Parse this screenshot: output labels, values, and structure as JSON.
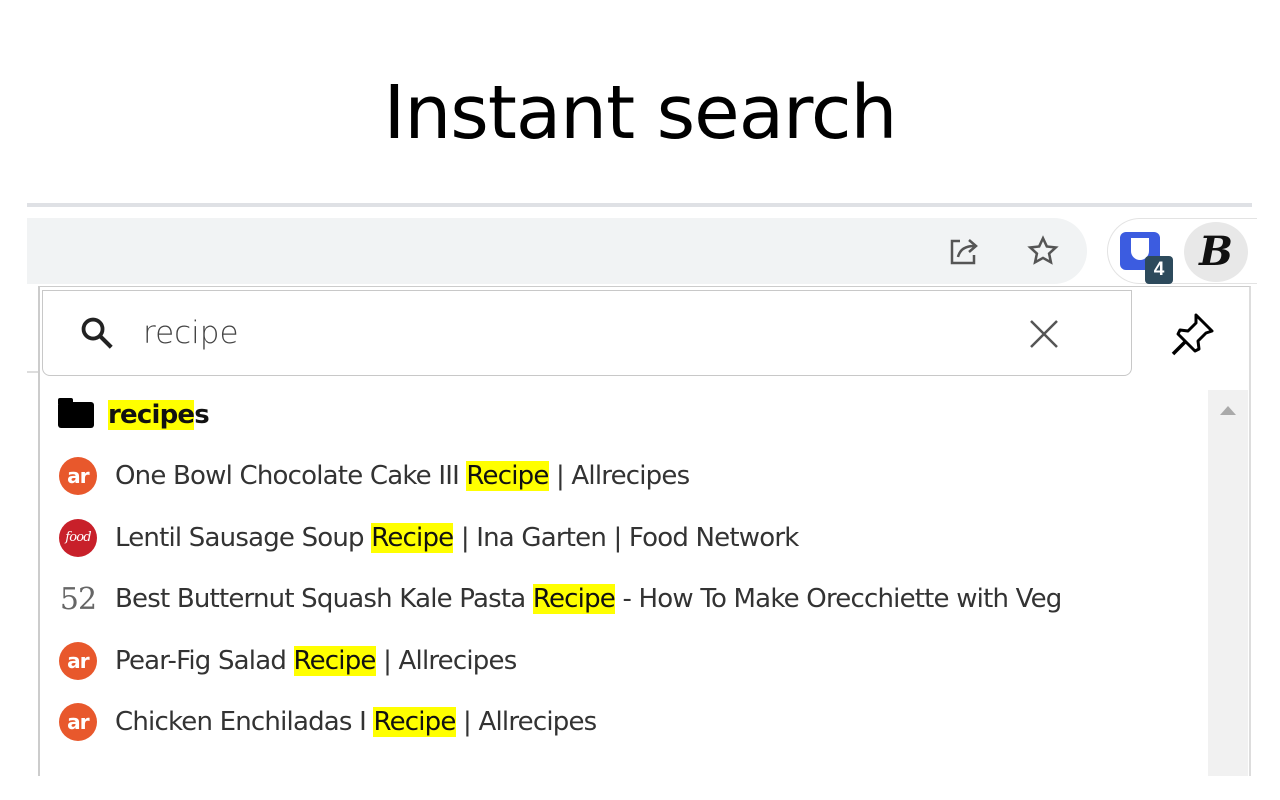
{
  "title": "Instant search",
  "toolbar": {
    "share_icon": "share-icon",
    "star_icon": "star-icon",
    "extension_badge": "4",
    "profile_letter": "B"
  },
  "search": {
    "query": "recipe",
    "clear_icon": "close-icon",
    "pin_icon": "pin-icon"
  },
  "folder": {
    "highlight": "recipe",
    "rest": "s"
  },
  "results": [
    {
      "icon": "allrecipes",
      "icon_text": "ar",
      "before": "One Bowl Chocolate Cake III ",
      "highlight": "Recipe",
      "after": " | Allrecipes"
    },
    {
      "icon": "food-network",
      "icon_text": "food",
      "before": "Lentil Sausage Soup ",
      "highlight": "Recipe",
      "after": " | Ina Garten | Food Network"
    },
    {
      "icon": "food52",
      "icon_text": "52",
      "before": "Best Butternut Squash Kale Pasta ",
      "highlight": "Recipe",
      "after": " - How To Make Orecchiette with Veg"
    },
    {
      "icon": "allrecipes",
      "icon_text": "ar",
      "before": "Pear-Fig Salad ",
      "highlight": "Recipe",
      "after": " | Allrecipes"
    },
    {
      "icon": "allrecipes",
      "icon_text": "ar",
      "before": "Chicken Enchiladas I ",
      "highlight": "Recipe",
      "after": " | Allrecipes"
    }
  ],
  "colors": {
    "highlight": "#ffff00",
    "allrecipes": "#e8582c",
    "food_network": "#c8202a"
  }
}
